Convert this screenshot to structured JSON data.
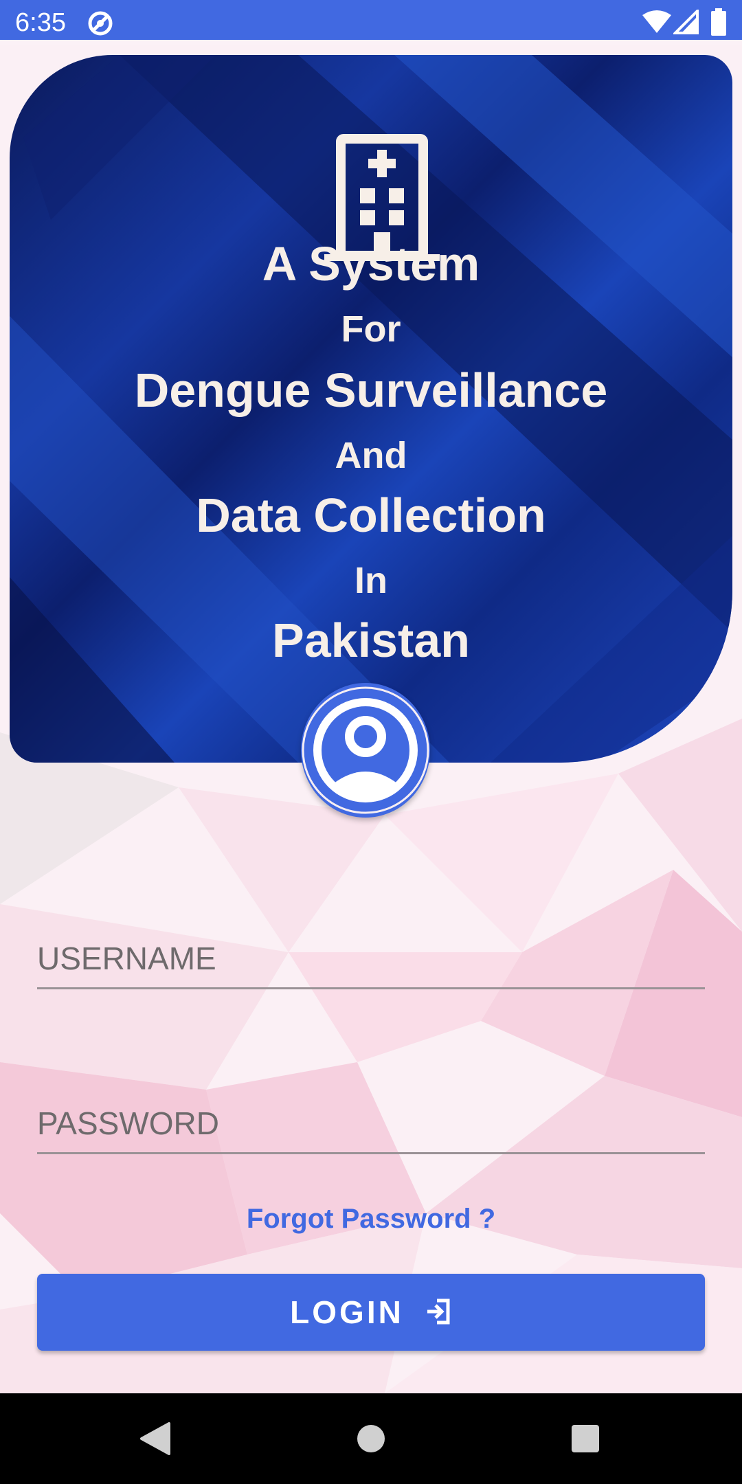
{
  "status_bar": {
    "time": "6:35",
    "icons": [
      "sync-circle-icon",
      "wifi-icon",
      "signal-icon",
      "battery-icon"
    ]
  },
  "header": {
    "icon": "hospital-icon",
    "title_lines": [
      "A System",
      "For",
      "Dengue Surveillance",
      "And",
      "Data Collection",
      "In",
      "Pakistan"
    ]
  },
  "avatar": {
    "icon": "account-circle-icon"
  },
  "form": {
    "username_placeholder": "USERNAME",
    "password_placeholder": "PASSWORD",
    "forgot_label": "Forgot Password ?",
    "login_label": "LOGIN",
    "login_icon": "login-icon"
  },
  "nav_bar": {
    "icons": [
      "back-icon",
      "home-icon",
      "recents-icon"
    ]
  },
  "colors": {
    "accent": "#4169e1",
    "header_dark": "#0b1a5c",
    "header_light": "#1e47bf",
    "title_text": "#f7efe8",
    "background": "#fbeef4"
  }
}
